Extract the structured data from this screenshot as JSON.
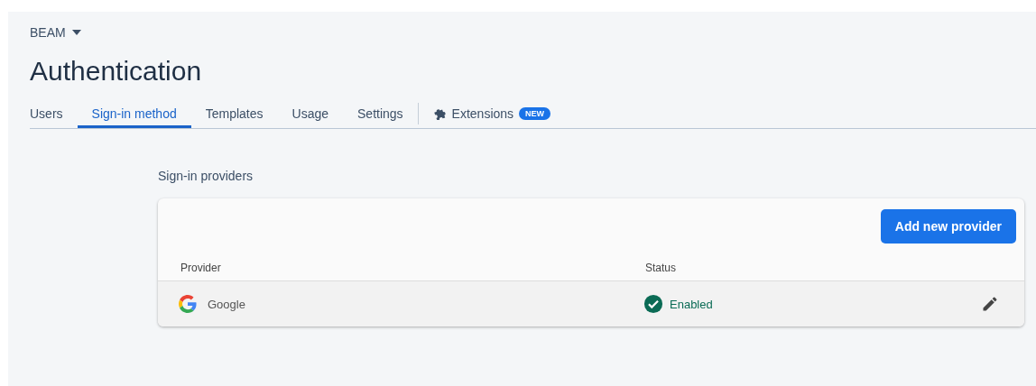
{
  "project": {
    "name": "BEAM"
  },
  "title": "Authentication",
  "tabs": [
    {
      "label": "Users",
      "selected": false,
      "kind": "plain"
    },
    {
      "label": "Sign-in method",
      "selected": true,
      "kind": "plain"
    },
    {
      "label": "Templates",
      "selected": false,
      "kind": "plain"
    },
    {
      "label": "Usage",
      "selected": false,
      "kind": "plain"
    },
    {
      "label": "Settings",
      "selected": false,
      "kind": "plain"
    },
    {
      "label": "Extensions",
      "selected": false,
      "kind": "extension",
      "badge": "NEW"
    }
  ],
  "section_title": "Sign-in providers",
  "add_button": "Add new provider",
  "table": {
    "columns": [
      "Provider",
      "Status"
    ],
    "rows": [
      {
        "provider": "Google",
        "status": "Enabled",
        "enabled": true
      }
    ]
  }
}
